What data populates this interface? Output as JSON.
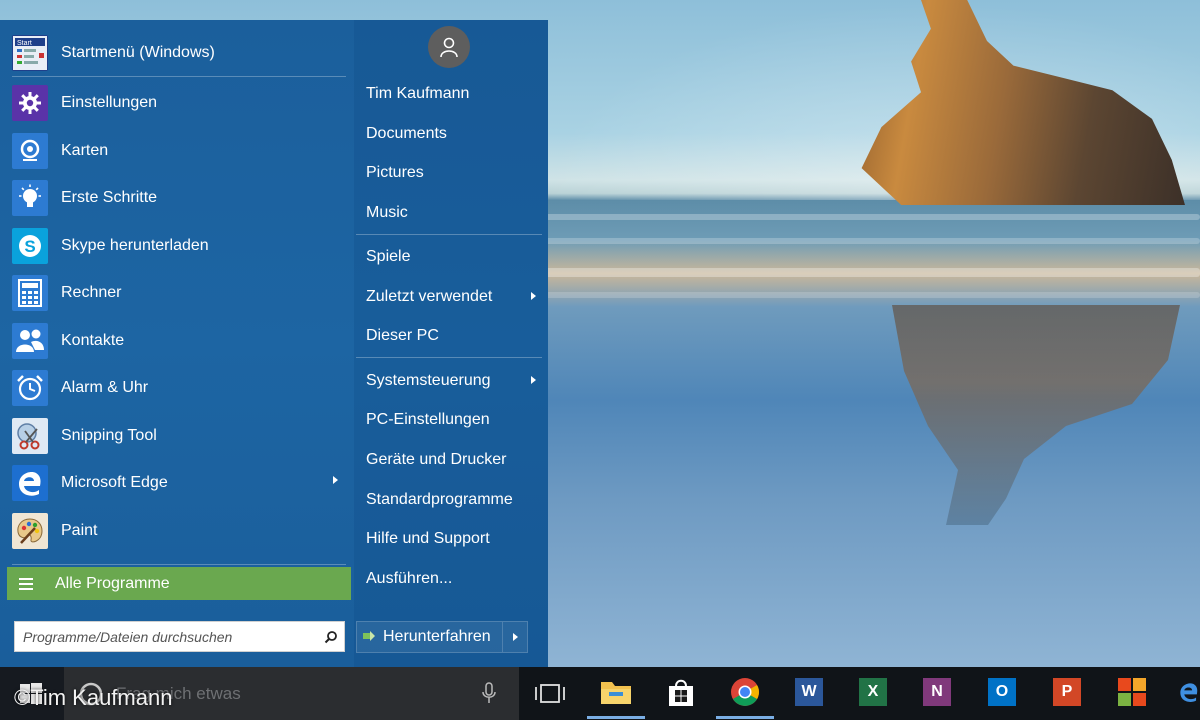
{
  "start_menu": {
    "pinned": {
      "label": "Startmenü (Windows)",
      "icon": "start-menu-tile-icon"
    },
    "apps": [
      {
        "label": "Einstellungen",
        "icon": "gear-icon",
        "color": "#5a33a8"
      },
      {
        "label": "Karten",
        "icon": "maps-pin-icon",
        "color": "#2d7bd2"
      },
      {
        "label": "Erste Schritte",
        "icon": "lightbulb-icon",
        "color": "#2d7bd2"
      },
      {
        "label": "Skype herunterladen",
        "icon": "skype-icon",
        "color": "#0aa2dc"
      },
      {
        "label": "Rechner",
        "icon": "calculator-icon",
        "color": "#2d7bd2"
      },
      {
        "label": "Kontakte",
        "icon": "contacts-icon",
        "color": "#2d7bd2"
      },
      {
        "label": "Alarm & Uhr",
        "icon": "alarm-clock-icon",
        "color": "#2d7bd2"
      },
      {
        "label": "Snipping Tool",
        "icon": "scissors-icon",
        "color": "#dfe9f4"
      },
      {
        "label": "Microsoft Edge",
        "icon": "edge-icon",
        "color": "#1d6fd0",
        "has_submenu": true
      },
      {
        "label": "Paint",
        "icon": "palette-icon",
        "color": "#f0e6d4"
      }
    ],
    "all_programs": {
      "label": "Alle Programme",
      "color": "#6aa84f"
    },
    "search": {
      "placeholder": "Programme/Dateien durchsuchen",
      "value": ""
    },
    "right_pane": {
      "user_name": "Tim Kaufmann",
      "links": [
        {
          "label": "Documents"
        },
        {
          "label": "Pictures"
        },
        {
          "label": "Music"
        },
        {
          "label": "Spiele"
        },
        {
          "label": "Zuletzt verwendet",
          "has_submenu": true
        },
        {
          "label": "Dieser PC"
        },
        {
          "label": "Systemsteuerung",
          "has_submenu": true
        },
        {
          "label": "PC-Einstellungen"
        },
        {
          "label": "Geräte und Drucker"
        },
        {
          "label": "Standardprogramme"
        },
        {
          "label": "Hilfe und Support"
        },
        {
          "label": "Ausführen..."
        }
      ],
      "shutdown": {
        "label": "Herunterfahren"
      }
    }
  },
  "taskbar": {
    "search_placeholder": "Frag mich etwas",
    "apps": [
      {
        "name": "file-explorer",
        "icon": "folder-icon"
      },
      {
        "name": "store",
        "icon": "store-bag-icon"
      },
      {
        "name": "chrome",
        "icon": "chrome-icon"
      },
      {
        "name": "word",
        "icon": "word-icon",
        "letter": "W",
        "color": "#2b579a"
      },
      {
        "name": "excel",
        "icon": "excel-icon",
        "letter": "X",
        "color": "#217346"
      },
      {
        "name": "onenote",
        "icon": "onenote-icon",
        "letter": "N",
        "color": "#80397b"
      },
      {
        "name": "outlook",
        "icon": "outlook-icon",
        "letter": "O",
        "color": "#0072c6"
      },
      {
        "name": "powerpoint",
        "icon": "powerpoint-icon",
        "letter": "P",
        "color": "#d24726"
      },
      {
        "name": "windows-tiles",
        "icon": "windows-tiles-icon"
      },
      {
        "name": "edge",
        "icon": "edge-icon"
      }
    ]
  },
  "watermark": "©Tim Kaufmann"
}
